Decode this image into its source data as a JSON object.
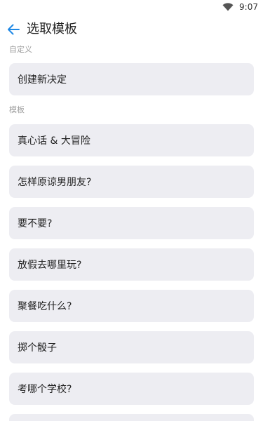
{
  "status_bar": {
    "time": "9:07",
    "wifi_icon": "wifi-icon"
  },
  "header": {
    "back_icon": "arrow-left-icon",
    "title": "选取模板"
  },
  "custom_section": {
    "label": "自定义",
    "items": [
      "创建新决定"
    ]
  },
  "template_section": {
    "label": "模板",
    "items": [
      "真心话 & 大冒险",
      "怎样原谅男朋友?",
      "要不要?",
      "放假去哪里玩?",
      "聚餐吃什么?",
      "掷个骰子",
      "考哪个学校?",
      ""
    ]
  },
  "colors": {
    "accent": "#1e88e5",
    "card_bg": "#ededf2",
    "section_label": "#9e9e9e"
  }
}
